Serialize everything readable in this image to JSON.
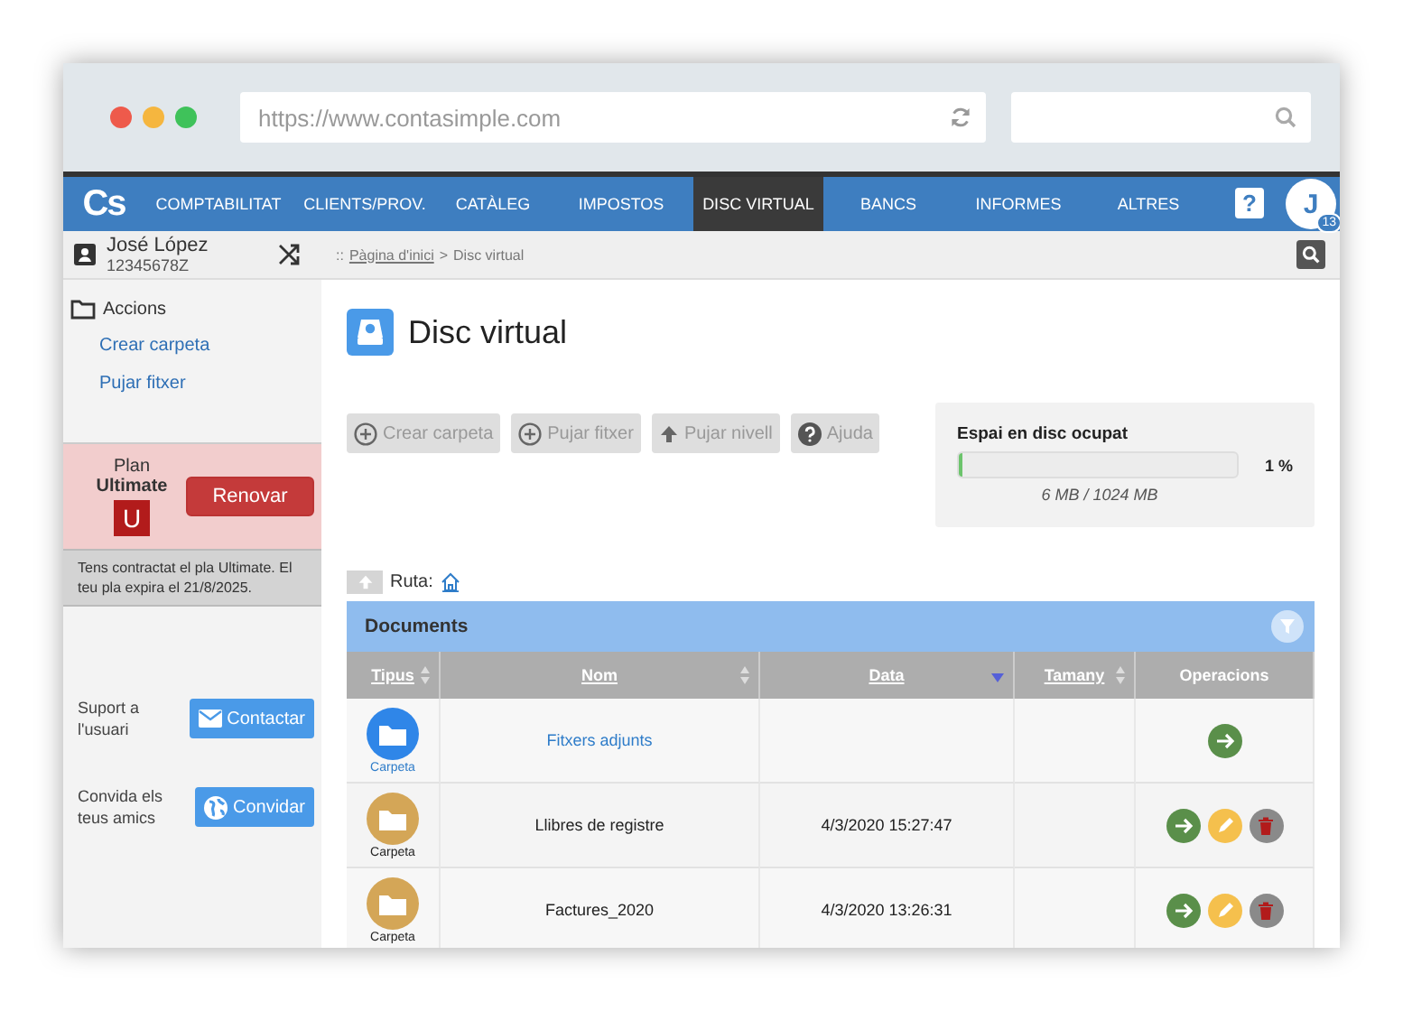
{
  "browser": {
    "url": "https://www.contasimple.com"
  },
  "nav": {
    "logo": "Cs",
    "items": [
      {
        "label": "COMPTABILITAT",
        "selected": false
      },
      {
        "label": "CLIENTS/PROV.",
        "selected": false
      },
      {
        "label": "CATÀLEG",
        "selected": false
      },
      {
        "label": "IMPOSTOS",
        "selected": false
      },
      {
        "label": "DISC VIRTUAL",
        "selected": true
      },
      {
        "label": "BANCS",
        "selected": false
      },
      {
        "label": "INFORMES",
        "selected": false
      },
      {
        "label": "ALTRES",
        "selected": false
      }
    ],
    "help": "?",
    "avatar": {
      "initial": "J",
      "badge": "13"
    }
  },
  "user": {
    "name": "José López",
    "id": "12345678Z"
  },
  "breadcrumb": {
    "prefix": "::",
    "home": "Pàgina d'inici",
    "separator": ">",
    "current": "Disc virtual"
  },
  "sidebar": {
    "section": "Accions",
    "links": [
      "Crear carpeta",
      "Pujar fitxer"
    ],
    "plan": {
      "label": "Plan",
      "name": "Ultimate",
      "badge": "U",
      "button": "Renovar",
      "note": "Tens contractat el pla Ultimate. El teu pla expira el 21/8/2025."
    },
    "support": [
      {
        "kind": "contact",
        "text": "Suport a l'usuari",
        "button": "Contactar"
      },
      {
        "kind": "invite",
        "text": "Convida els teus amics",
        "button": "Convidar"
      }
    ]
  },
  "page": {
    "title": "Disc virtual",
    "toolbar": [
      {
        "kind": "add",
        "label": "Crear carpeta"
      },
      {
        "kind": "add",
        "label": "Pujar fitxer"
      },
      {
        "kind": "up",
        "label": "Pujar nivell"
      },
      {
        "kind": "help",
        "label": "Ajuda"
      }
    ],
    "storage": {
      "title": "Espai en disc ocupat",
      "level": 0.01,
      "percent": "1 %",
      "usage": "6 MB / 1024 MB"
    },
    "path_label": "Ruta:"
  },
  "table": {
    "title": "Documents",
    "columns": [
      {
        "label": "Tipus",
        "sortable": true,
        "sorted": false
      },
      {
        "label": "Nom",
        "sortable": true,
        "sorted": false
      },
      {
        "label": "Data",
        "sortable": true,
        "sorted": true
      },
      {
        "label": "Tamany",
        "sortable": true,
        "sorted": false
      },
      {
        "label": "Operacions",
        "sortable": false,
        "sorted": false
      }
    ],
    "rows": [
      {
        "kind": "shared",
        "type": "Carpeta",
        "name": "Fitxers adjunts",
        "editable": false
      },
      {
        "kind": "folder",
        "type": "Carpeta",
        "name": "Llibres de registre",
        "date": "4/3/2020 15:27:47",
        "editable": true
      },
      {
        "kind": "folder",
        "type": "Carpeta",
        "name": "Factures_2020",
        "date": "4/3/2020 13:26:31",
        "editable": true
      }
    ]
  }
}
